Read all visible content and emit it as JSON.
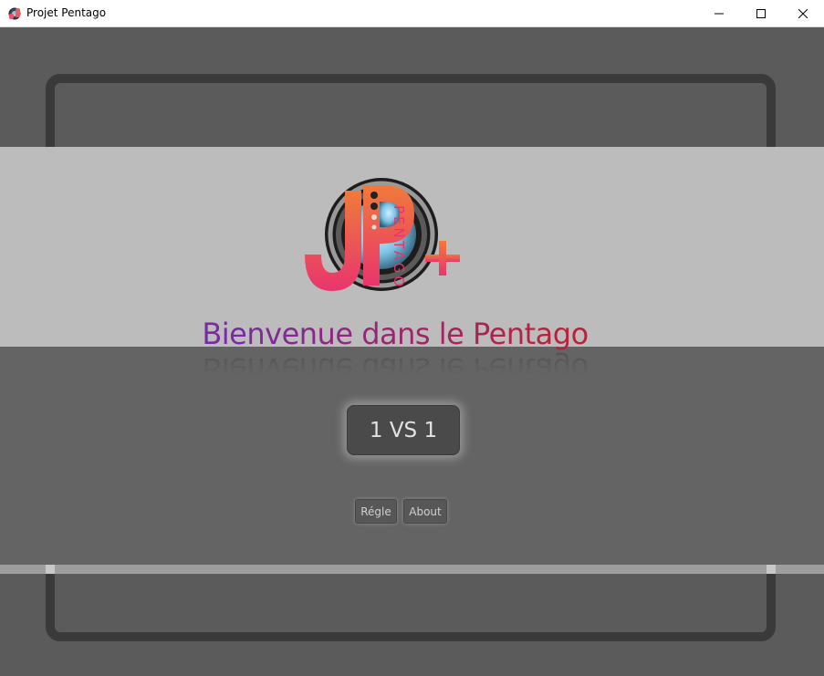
{
  "window": {
    "title": "Projet Pentago",
    "controls": {
      "minimize": "minimize-icon",
      "maximize": "maximize-icon",
      "close": "close-icon"
    }
  },
  "logo": {
    "letters": "PENTAGO",
    "colors": {
      "gradient_top": "#f07a3a",
      "gradient_bottom": "#e8356e",
      "sphere": "#7ec3e6"
    }
  },
  "welcome": {
    "text": "Bienvenue dans le Pentago"
  },
  "menu": {
    "play_label": "1 VS 1",
    "rules_label": "Régle",
    "about_label": "About"
  },
  "colors": {
    "light_band": "#bcbcbc",
    "dark_band": "#646464",
    "frame": "#3a3a3a",
    "title_gradient": [
      "#7a2aa3",
      "#b8233a"
    ]
  }
}
